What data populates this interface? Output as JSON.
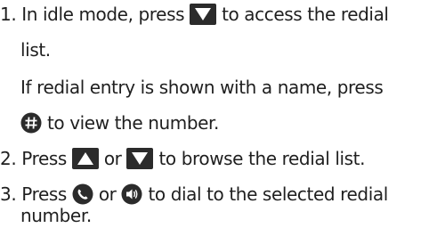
{
  "steps": [
    {
      "number": "1.",
      "text_a": "In idle mode, press",
      "icon_a": "down-arrow-key-icon",
      "text_b": "to access the redial",
      "cont": "list."
    },
    {
      "note_line1": "If redial entry is shown with a name, press",
      "note_icon": "hash-key-icon",
      "note_line2": "to view the number."
    },
    {
      "number": "2.",
      "text_a": "Press",
      "icon_a": "up-arrow-key-icon",
      "text_or": "or",
      "icon_b": "down-arrow-key-icon",
      "text_b": "to browse the redial list."
    },
    {
      "number": "3.",
      "text_a": "Press",
      "icon_a": "talk-key-icon",
      "text_or": "or",
      "icon_b": "speaker-key-icon",
      "text_b": "to dial to the selected redial",
      "cont": "number."
    }
  ],
  "colors": {
    "text": "#1f1f1f",
    "icon_fill": "#2b2b2b",
    "icon_glyph": "#ffffff"
  }
}
